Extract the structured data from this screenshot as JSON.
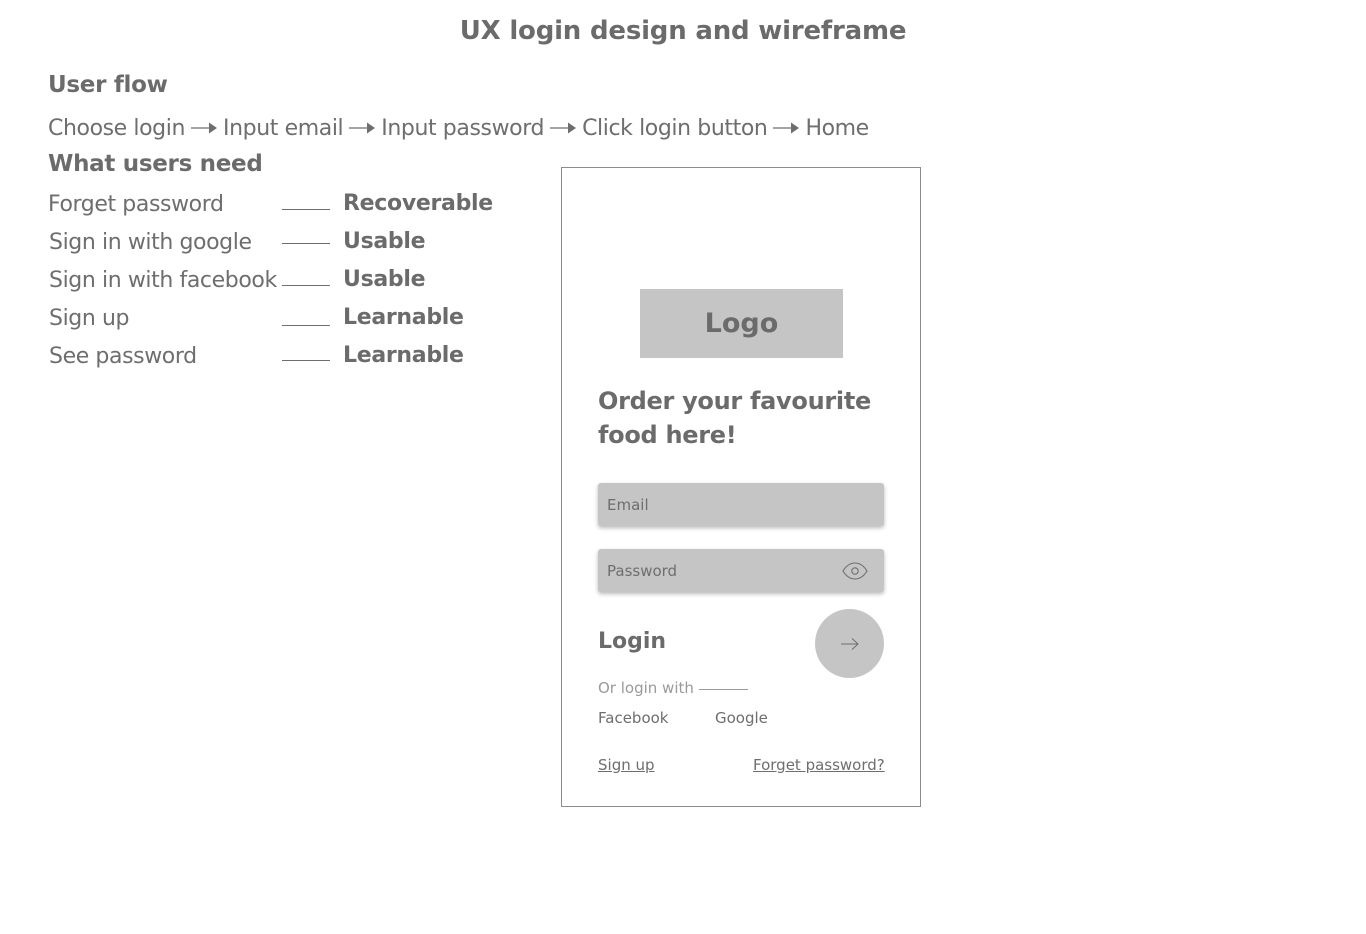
{
  "page": {
    "title": "UX login design and wireframe"
  },
  "user_flow": {
    "heading": "User flow",
    "steps": [
      "Choose login",
      "Input email",
      "Input password",
      "Click login button",
      "Home"
    ]
  },
  "needs": {
    "heading": "What users need",
    "items": [
      {
        "label": "Forget password",
        "quality": "Recoverable"
      },
      {
        "label": "Sign in with google",
        "quality": "Usable"
      },
      {
        "label": "Sign in with facebook",
        "quality": "Usable"
      },
      {
        "label": "Sign up",
        "quality": "Learnable"
      },
      {
        "label": "See password",
        "quality": "Learnable"
      }
    ]
  },
  "wireframe": {
    "logo_text": "Logo",
    "tagline": "Order your favourite food here!",
    "email_placeholder": "Email",
    "password_placeholder": "Password",
    "password_toggle_icon": "eye-icon",
    "login_label": "Login",
    "login_button_icon": "arrow-right-icon",
    "or_login_with": "Or login with",
    "social": [
      "Facebook",
      "Google"
    ],
    "sign_up": "Sign up",
    "forget_password": "Forget password?"
  },
  "colors": {
    "text": "#6e6e6e",
    "placeholder_fill": "#c6c5c6",
    "muted": "#9a9a9a"
  }
}
